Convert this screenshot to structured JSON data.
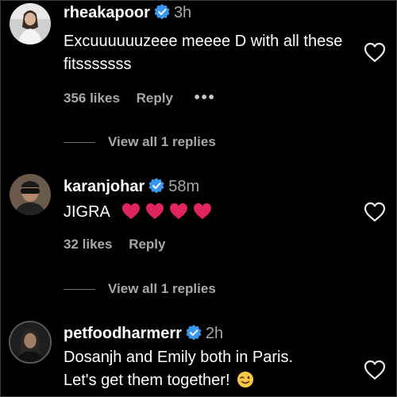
{
  "comments": [
    {
      "username": "rheakapoor",
      "time": "3h",
      "text": "Excuuuuuuzeee meeee D with all these fitsssssss",
      "likes": "356 likes",
      "reply": "Reply",
      "more": "•••",
      "view_replies": "View all 1 replies",
      "avatar": "portrait-photo"
    },
    {
      "username": "karanjohar",
      "time": "58m",
      "text": "JIGRA",
      "emojis": [
        "red-heart",
        "red-heart",
        "red-heart",
        "red-heart"
      ],
      "likes": "32 likes",
      "reply": "Reply",
      "view_replies": "View all 1 replies",
      "avatar": "portrait-photo"
    },
    {
      "username": "petfoodharmerr",
      "time": "2h",
      "text_line1": "Dosanjh and Emily both in Paris.",
      "text_line2": "Let's get them together!",
      "emoji": "winking-face",
      "avatar": "portrait-photo"
    }
  ],
  "colors": {
    "background": "#000000",
    "text": "#ffffff",
    "secondary": "#a8a8a8",
    "verified": "#3897f0",
    "heart_emoji": "#e0245e"
  }
}
